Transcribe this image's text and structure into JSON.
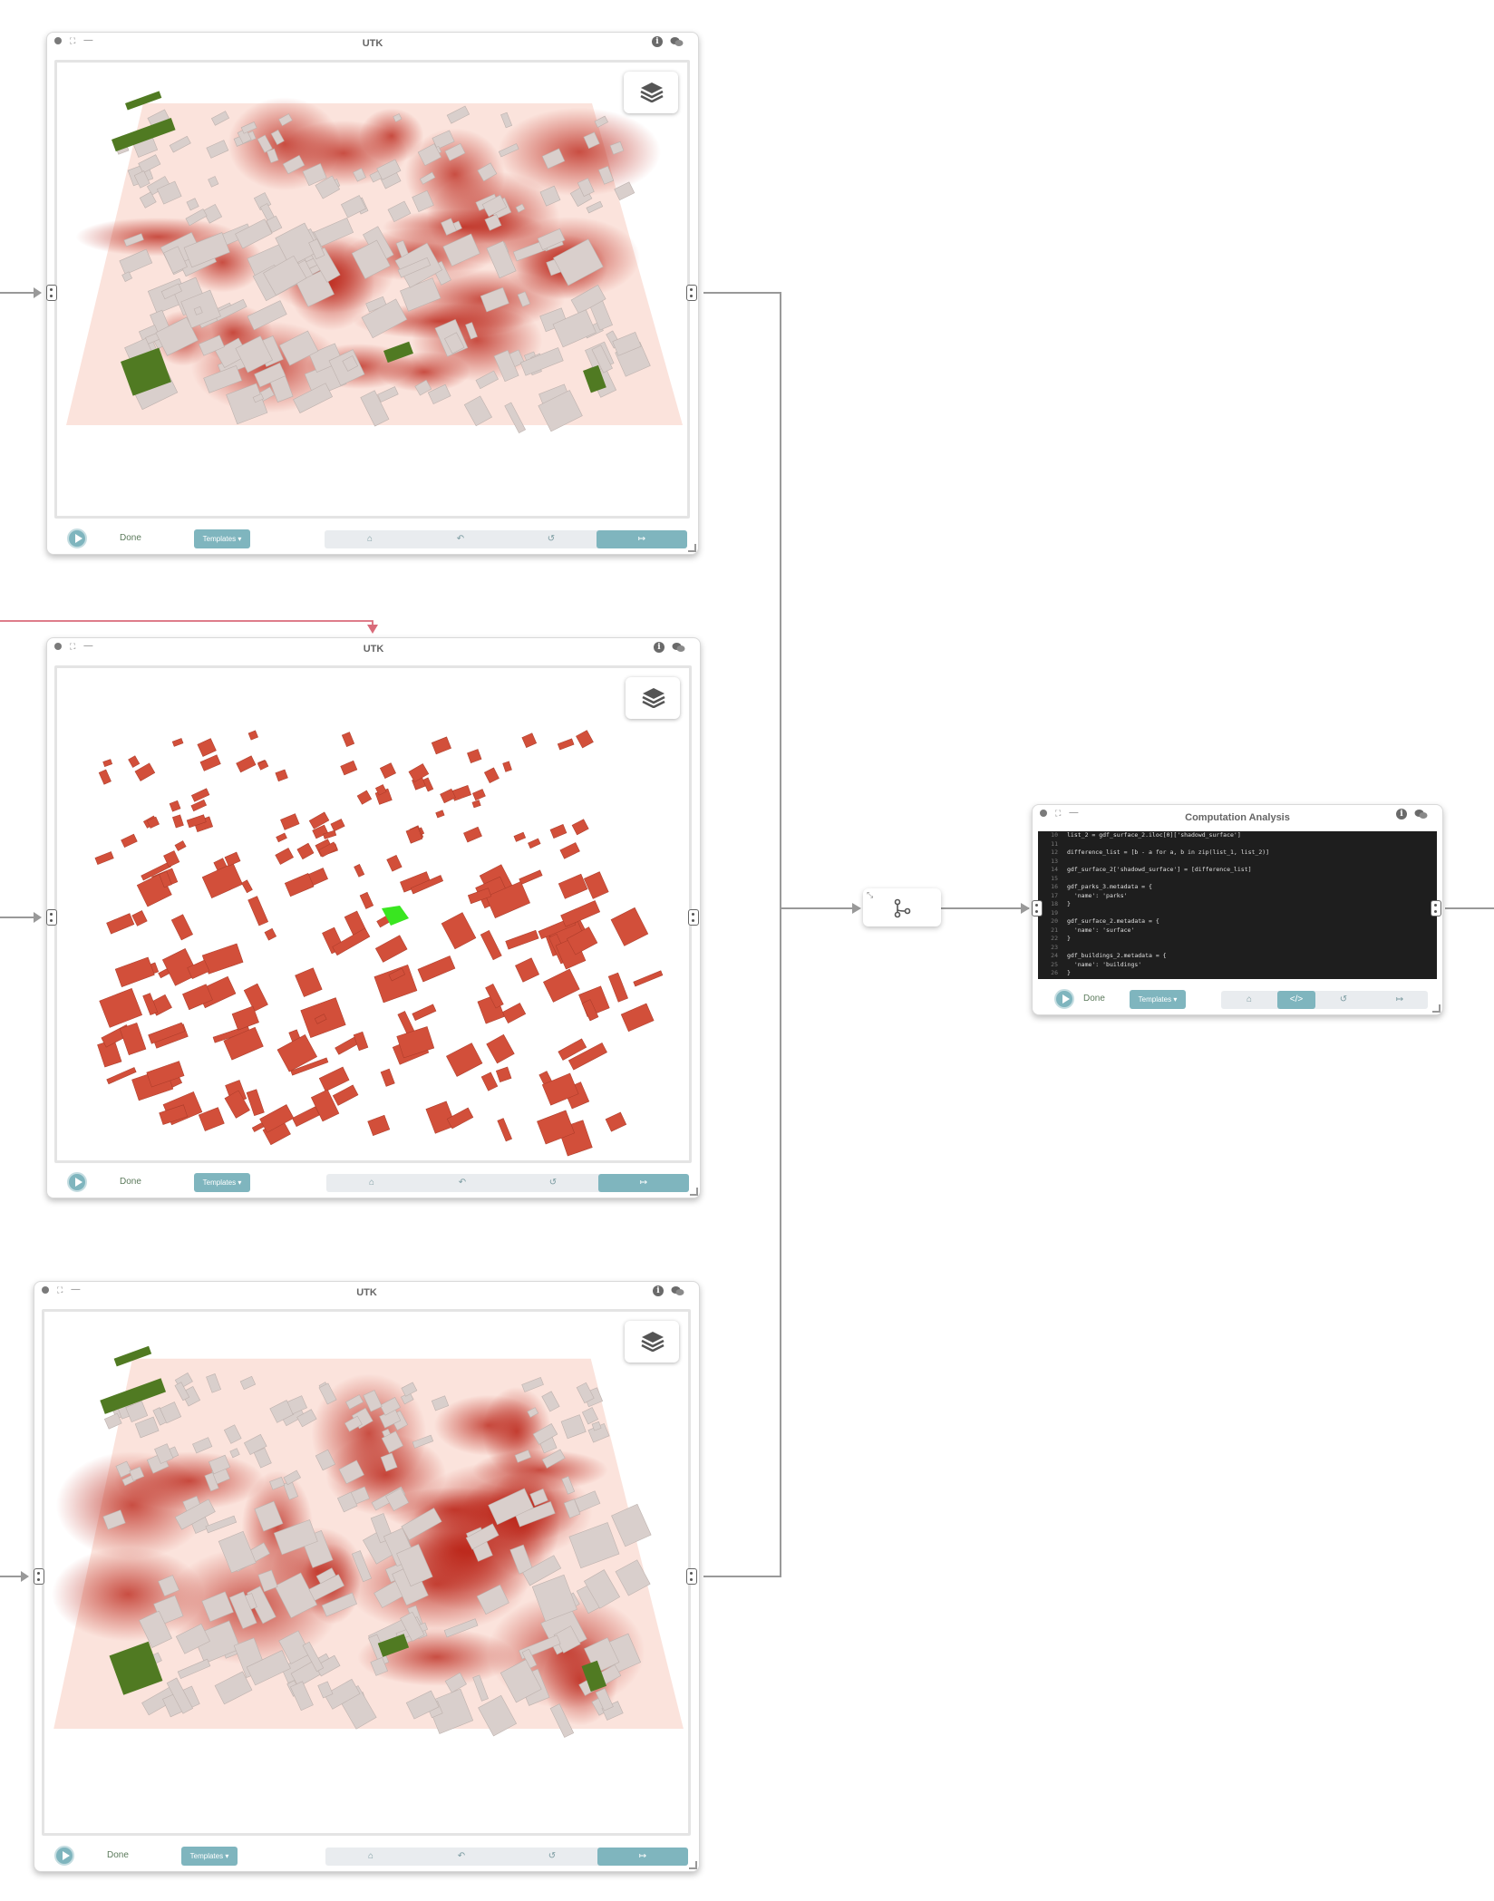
{
  "colors": {
    "accent": "#7fb5be",
    "wire": "#999999",
    "wire_highlight": "#d96b7a",
    "heat_light": "#fbe3dc",
    "heat_dark": "#b81c0f",
    "building": "#d9cfcc",
    "building_red": "#d24f3a",
    "park": "#507a22",
    "selected": "#39e620"
  },
  "utk_nodes": [
    {
      "title": "UTK",
      "status": "Done",
      "templates_label": "Templates ▾",
      "map": "shadow-heatmap",
      "tools": [
        "⌂",
        "↶",
        "↺",
        "↦"
      ]
    },
    {
      "title": "UTK",
      "status": "Done",
      "templates_label": "Templates ▾",
      "map": "buildings-selected",
      "tools": [
        "⌂",
        "↶",
        "↺",
        "↦"
      ]
    },
    {
      "title": "UTK",
      "status": "Done",
      "templates_label": "Templates ▾",
      "map": "shadow-heatmap",
      "tools": [
        "⌂",
        "↶",
        "↺",
        "↦"
      ]
    }
  ],
  "computation": {
    "title": "Computation Analysis",
    "status": "Done",
    "templates_label": "Templates ▾",
    "tools": [
      "⌂",
      "</>",
      "↺",
      "↦"
    ],
    "code": [
      {
        "n": "10",
        "t": "list_2 = gdf_surface_2.iloc[0]['shadowd_surface']"
      },
      {
        "n": "11",
        "t": ""
      },
      {
        "n": "12",
        "t": "difference_list = [b - a for a, b in zip(list_1, list_2)]"
      },
      {
        "n": "13",
        "t": ""
      },
      {
        "n": "14",
        "t": "gdf_surface_2['shadowd_surface'] = [difference_list]"
      },
      {
        "n": "15",
        "t": ""
      },
      {
        "n": "16",
        "t": "gdf_parks_3.metadata = {"
      },
      {
        "n": "17",
        "t": "  'name': 'parks'"
      },
      {
        "n": "18",
        "t": "}"
      },
      {
        "n": "19",
        "t": ""
      },
      {
        "n": "20",
        "t": "gdf_surface_2.metadata = {"
      },
      {
        "n": "21",
        "t": "  'name': 'surface'"
      },
      {
        "n": "22",
        "t": "}"
      },
      {
        "n": "23",
        "t": ""
      },
      {
        "n": "24",
        "t": "gdf_buildings_2.metadata = {"
      },
      {
        "n": "25",
        "t": "  'name': 'buildings'"
      },
      {
        "n": "26",
        "t": "}"
      }
    ]
  }
}
